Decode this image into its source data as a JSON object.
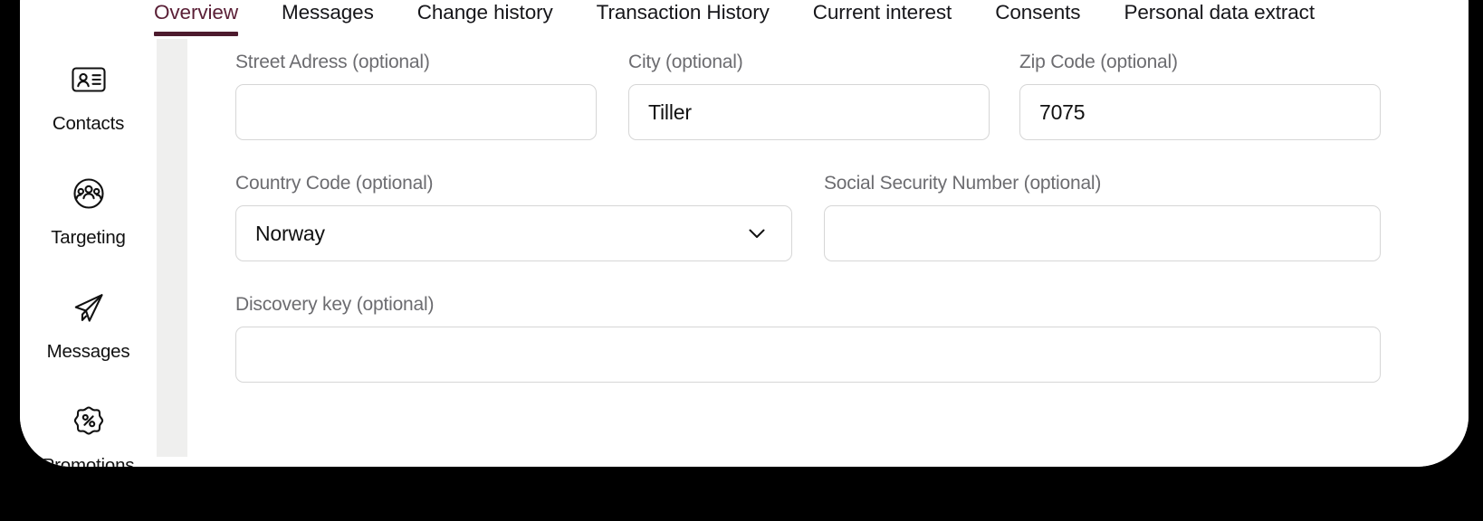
{
  "window": {
    "background_color": "#000000",
    "card_color": "#ffffff",
    "accent_color": "#4d1b2e",
    "gutter_color": "#efefee"
  },
  "tabs": [
    {
      "label": "Overview",
      "active": true,
      "name": "tab-overview"
    },
    {
      "label": "Messages",
      "active": false,
      "name": "tab-messages"
    },
    {
      "label": "Change history",
      "active": false,
      "name": "tab-change-history"
    },
    {
      "label": "Transaction History",
      "active": false,
      "name": "tab-transaction-history"
    },
    {
      "label": "Current interest",
      "active": false,
      "name": "tab-current-interest"
    },
    {
      "label": "Consents",
      "active": false,
      "name": "tab-consents"
    },
    {
      "label": "Personal data extract",
      "active": false,
      "name": "tab-personal-data-extract"
    }
  ],
  "sidebar": {
    "items": [
      {
        "label": "Contacts",
        "icon": "id-card-icon",
        "name": "sidebar-item-contacts"
      },
      {
        "label": "Targeting",
        "icon": "people-circle-icon",
        "name": "sidebar-item-targeting"
      },
      {
        "label": "Messages",
        "icon": "paper-plane-icon",
        "name": "sidebar-item-messages"
      },
      {
        "label": "Promotions",
        "icon": "percent-badge-icon",
        "name": "sidebar-item-promotions"
      }
    ]
  },
  "form": {
    "street_address": {
      "label": "Street Adress (optional)",
      "value": "",
      "placeholder": ""
    },
    "city": {
      "label": "City (optional)",
      "value": "Tiller",
      "placeholder": ""
    },
    "zip_code": {
      "label": "Zip Code (optional)",
      "value": "7075",
      "placeholder": ""
    },
    "country_code": {
      "label": "Country Code (optional)",
      "value": "Norway",
      "placeholder": ""
    },
    "ssn": {
      "label": "Social Security Number (optional)",
      "value": "",
      "placeholder": ""
    },
    "discovery_key": {
      "label": "Discovery key (optional)",
      "value": "",
      "placeholder": ""
    }
  }
}
